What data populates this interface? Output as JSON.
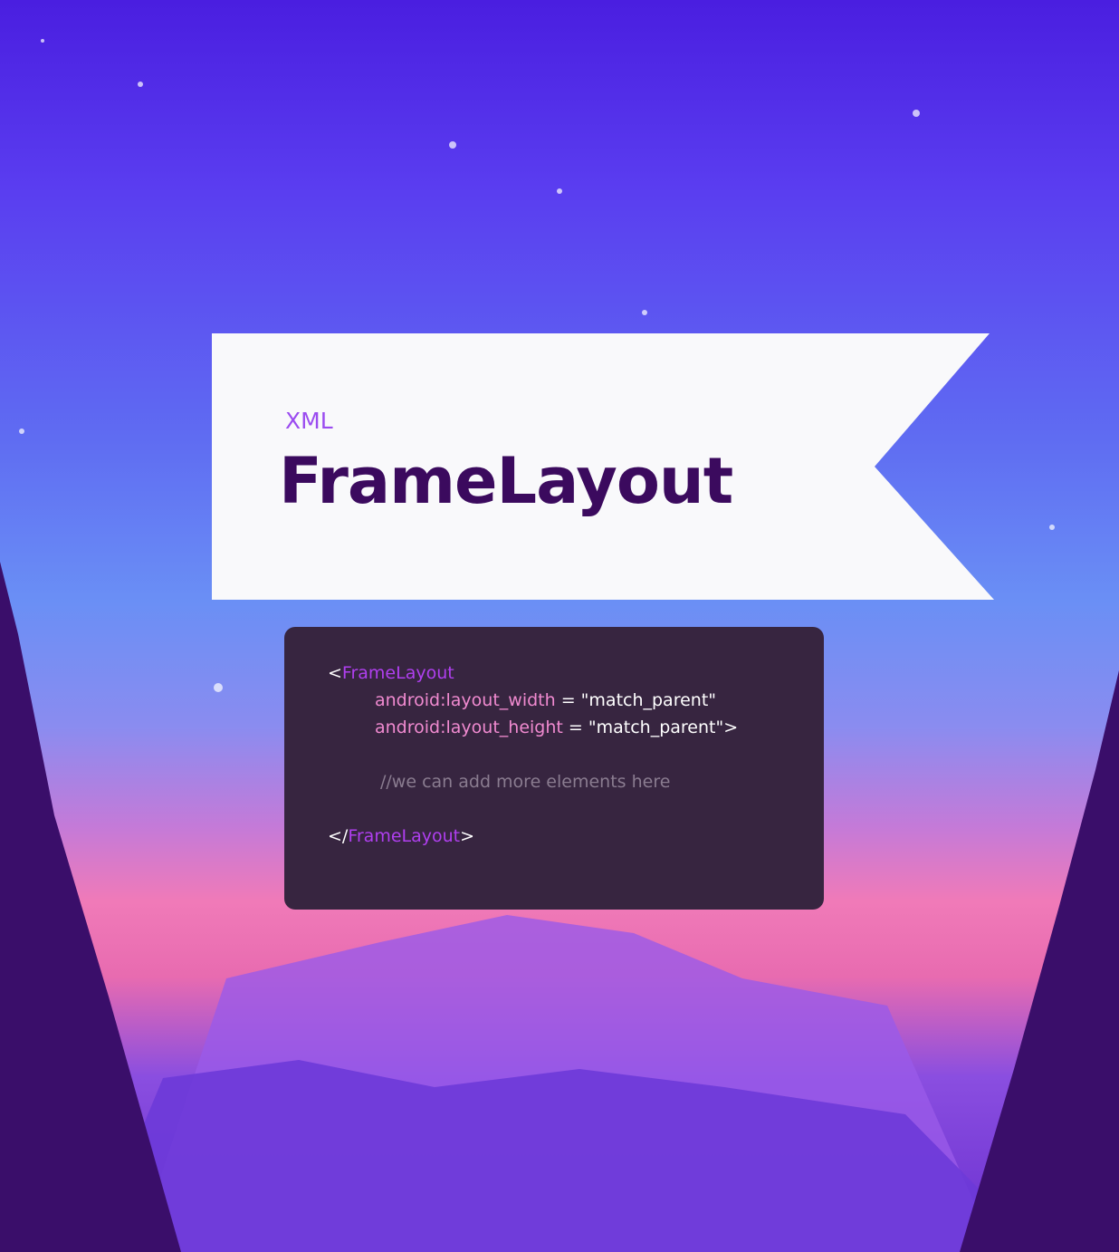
{
  "banner": {
    "subtitle": "XML",
    "title": "FrameLayout"
  },
  "code": {
    "open_bracket": "<",
    "open_tag": "FrameLayout",
    "attr1_name": "android:layout_width",
    "attr1_eq": " = ",
    "attr1_value": "\"match_parent\"",
    "attr2_name": "android:layout_height",
    "attr2_eq": " = ",
    "attr2_value": "\"match_parent\">",
    "comment": "//we can add more elements here",
    "close_bracket": "</",
    "close_tag": "FrameLayout",
    "close_end": ">"
  },
  "colors": {
    "tag": "#b03ff0",
    "attribute": "#f08ad0",
    "comment": "#8a7c90",
    "title": "#3b0a5e",
    "code_bg": "#372540"
  }
}
